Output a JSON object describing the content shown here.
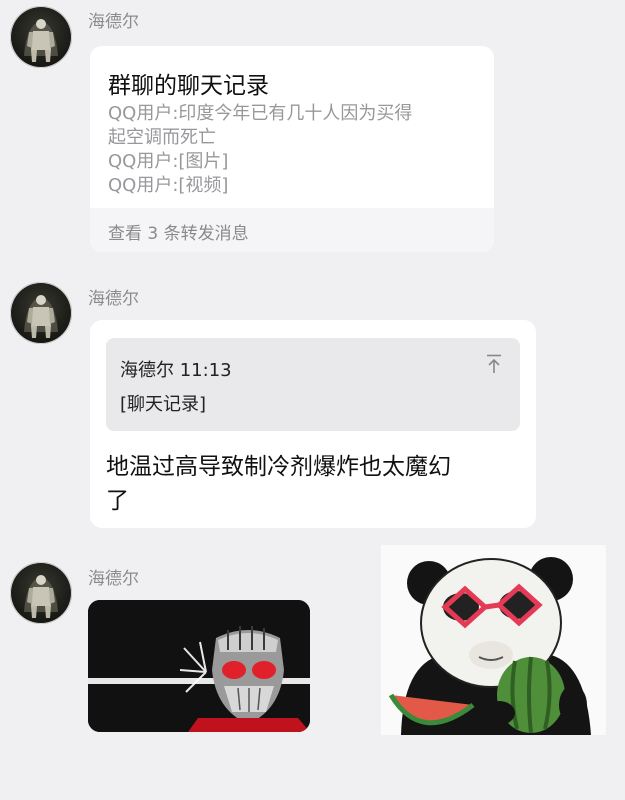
{
  "messages": [
    {
      "sender": "海德尔",
      "type": "forwarded-chat",
      "card": {
        "title": "群聊的聊天记录",
        "lines": [
          "QQ用户:印度今年已有几十人因为买得",
          "起空调而死亡",
          "QQ用户:[图片]",
          "QQ用户:[视频]"
        ],
        "footer": "查看 3 条转发消息"
      }
    },
    {
      "sender": "海德尔",
      "type": "reply",
      "quote": {
        "header": "海德尔 11:13",
        "body": "[聊天记录]"
      },
      "text_lines": [
        "地温过高导致制冷剂爆炸也太魔幻",
        "了"
      ]
    },
    {
      "sender": "海德尔",
      "type": "images",
      "images": [
        "masked-rider-image",
        "panda-watermelon-sticker"
      ]
    }
  ],
  "colors": {
    "background": "#f0f0f2",
    "bubble": "#ffffff",
    "sender_name": "#8b8b8f",
    "quote_bg": "#e9e9eb"
  }
}
